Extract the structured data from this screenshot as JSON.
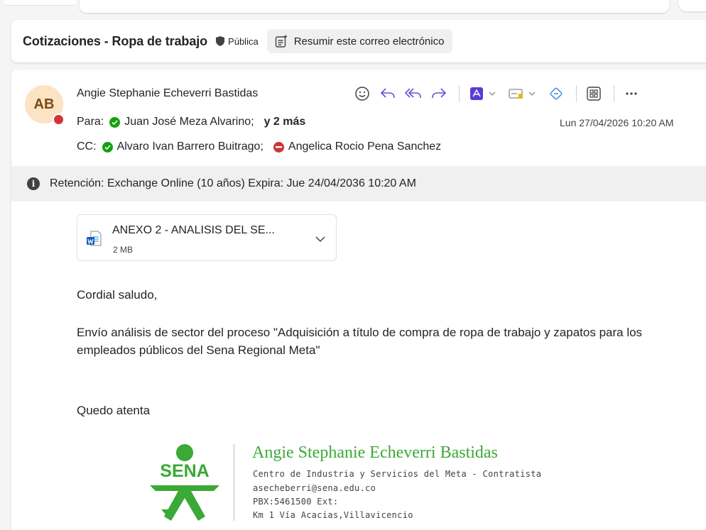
{
  "subject": {
    "title": "Cotizaciones - Ropa de trabajo",
    "label": "Pública",
    "summarize": "Resumir este correo electrónico"
  },
  "message": {
    "avatar_initials": "AB",
    "sender": "Angie Stephanie Echeverri Bastidas",
    "to_label": "Para:",
    "to_recipient": "Juan José Meza Alvarino;",
    "to_more": "y 2 más",
    "cc_label": "CC:",
    "cc_recipient_1": "Alvaro Ivan Barrero Buitrago;",
    "cc_recipient_2": "Angelica Rocio Pena Sanchez",
    "date": "Lun 27/04/2026 10:20 AM",
    "retention": "Retención: Exchange Online (10 años) Expira: Jue 24/04/2036 10:20 AM"
  },
  "attachment": {
    "name": "ANEXO 2 - ANALISIS DEL SE...",
    "size": "2 MB"
  },
  "body": {
    "greeting": "Cordial saludo,",
    "paragraph": "Envío análisis de sector del proceso \"Adquisición a título de compra de ropa de trabajo y zapatos para los empleados públicos del Sena Regional Meta\"",
    "closing": "Quedo atenta"
  },
  "signature": {
    "logo_text": "SENA",
    "name": "Angie Stephanie Echeverri Bastidas",
    "line1": "Centro de Industria y Servicios del Meta - Contratista",
    "line2": "asecheberri@sena.edu.co",
    "line3": "PBX:5461500 Ext:",
    "line4": "Km 1 Vía Acacias,Villavicencio"
  },
  "colors": {
    "sena_green": "#3aa935",
    "accent": "#6b4bd6",
    "presence_busy": "#d13438",
    "presence_available": "#13a10e"
  }
}
